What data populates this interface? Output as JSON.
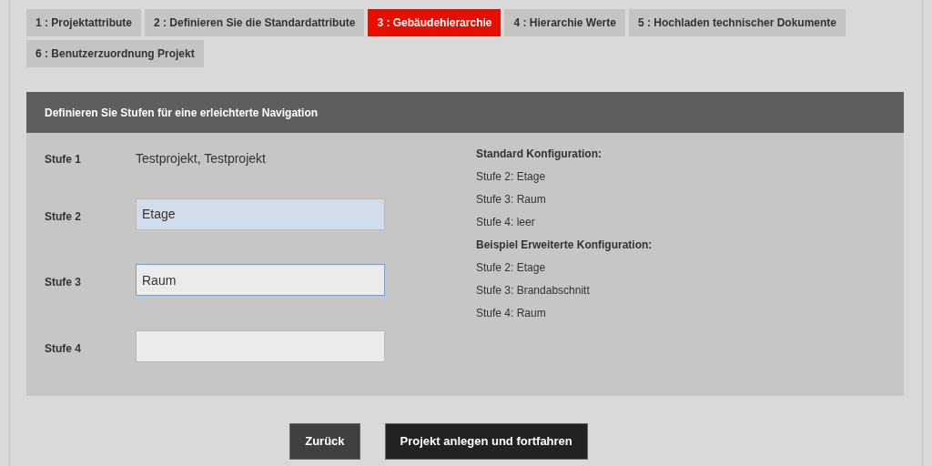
{
  "tabs": [
    {
      "label": "1 : Projektattribute",
      "selected": false
    },
    {
      "label": "2 : Definieren Sie die Standardattribute",
      "selected": false
    },
    {
      "label": "3 : Gebäudehierarchie",
      "selected": true
    },
    {
      "label": "4 : Hierarchie Werte",
      "selected": false
    },
    {
      "label": "5 : Hochladen technischer Dokumente",
      "selected": false
    },
    {
      "label": "6 : Benutzerzuordnung Projekt",
      "selected": false
    }
  ],
  "panel": {
    "title": "Definieren Sie Stufen für eine erleichterte Navigation",
    "levels": [
      {
        "label": "Stufe 1",
        "kind": "text",
        "value": "Testprojekt, Testprojekt"
      },
      {
        "label": "Stufe 2",
        "kind": "input",
        "value": "Etage",
        "autofilled": true,
        "focused": false
      },
      {
        "label": "Stufe 3",
        "kind": "input",
        "value": "Raum",
        "autofilled": false,
        "focused": true
      },
      {
        "label": "Stufe 4",
        "kind": "input",
        "autofilled": false,
        "focused": false
      }
    ],
    "info": [
      {
        "kind": "heading",
        "text": "Standard Konfiguration:"
      },
      {
        "kind": "line",
        "text": "Stufe 2: Etage"
      },
      {
        "kind": "line",
        "text": "Stufe 3: Raum"
      },
      {
        "kind": "line",
        "text": "Stufe 4: leer"
      },
      {
        "kind": "heading",
        "text": "Beispiel Erweiterte Konfiguration:"
      },
      {
        "kind": "line",
        "text": "Stufe 2: Etage"
      },
      {
        "kind": "line",
        "text": "Stufe 3: Brandabschnitt"
      },
      {
        "kind": "line",
        "text": "Stufe 4: Raum"
      }
    ]
  },
  "buttons": [
    {
      "label": "Zurück"
    },
    {
      "label": "Projekt anlegen und fortfahren"
    }
  ]
}
